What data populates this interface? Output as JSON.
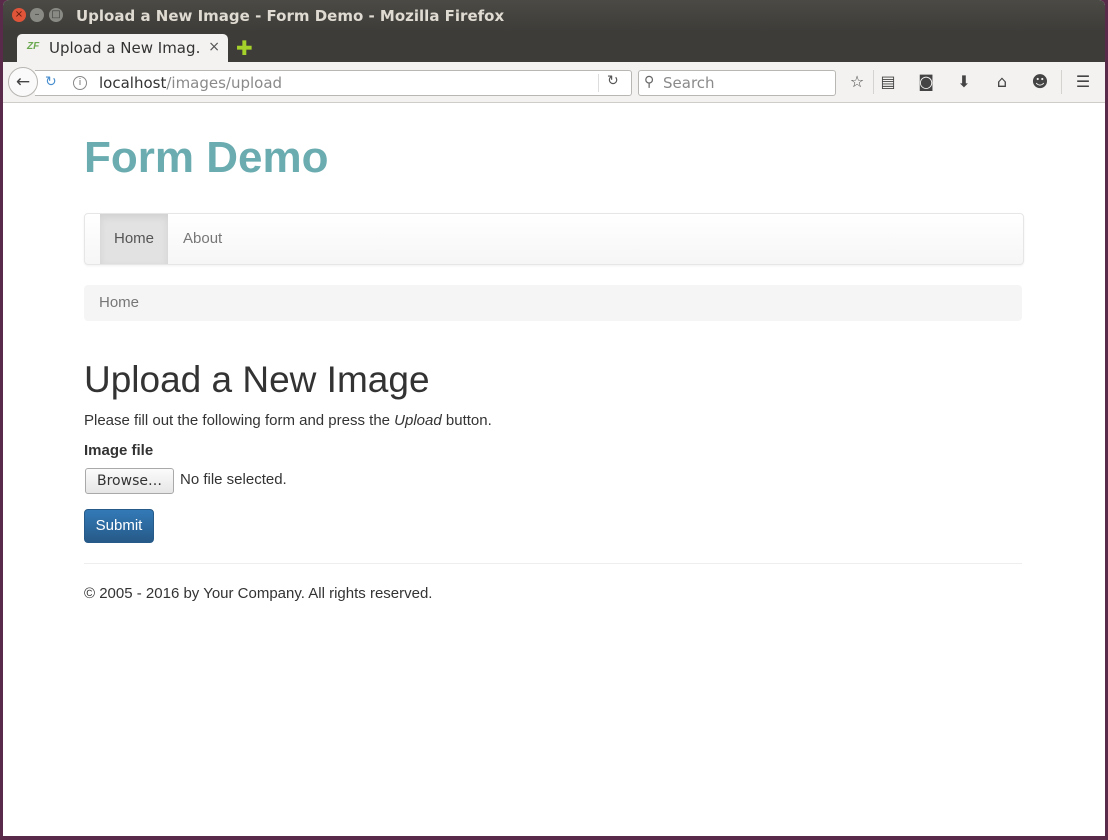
{
  "window": {
    "title": "Upload a New Image - Form Demo - Mozilla Firefox",
    "close_glyph": "×",
    "minimize_glyph": "–",
    "maximize_glyph": "□"
  },
  "tab": {
    "favicon": "ZF",
    "label": "Upload a New Imag…",
    "close_glyph": "×",
    "new_tab_glyph": "✚"
  },
  "toolbar": {
    "url_host": "localhost",
    "url_path": "/images/upload",
    "search_placeholder": "Search",
    "icons": [
      "back-icon",
      "reload-icon",
      "info-icon",
      "search-icon",
      "bookmark-star-icon",
      "reading-list-icon",
      "pocket-icon",
      "downloads-icon",
      "home-icon",
      "hello-icon",
      "menu-icon"
    ]
  },
  "page": {
    "brand": "Form Demo",
    "nav": {
      "home": "Home",
      "about": "About"
    },
    "breadcrumb": "Home",
    "heading": "Upload a New Image",
    "lead_before": "Please fill out the following form and press the ",
    "lead_em": "Upload",
    "lead_after": " button.",
    "field_label": "Image file",
    "browse_label": "Browse…",
    "no_file_text": "No file selected.",
    "submit_label": "Submit",
    "footer": "© 2005 - 2016 by Your Company. All rights reserved."
  },
  "colors": {
    "brand": "#6aacb0",
    "primary_button": "#337ab7",
    "titlebar": "#3d3c38"
  }
}
